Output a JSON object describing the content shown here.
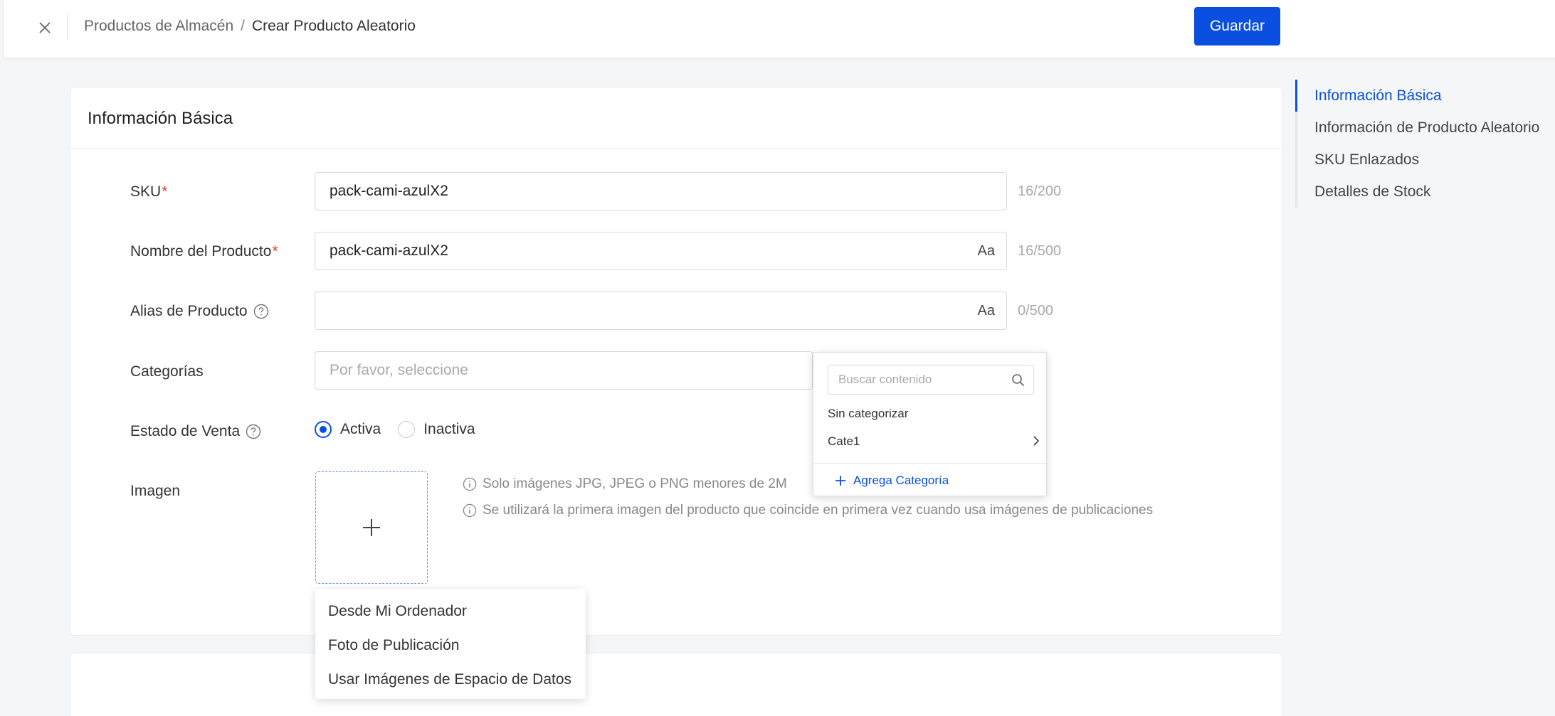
{
  "header": {
    "breadcrumb_parent": "Productos de Almacén",
    "breadcrumb_separator": "/",
    "breadcrumb_current": "Crear Producto Aleatorio",
    "save_label": "Guardar",
    "close_icon": "close-icon"
  },
  "basic_info": {
    "title": "Información Básica",
    "sku": {
      "label": "SKU",
      "required": "*",
      "value": "pack-cami-azulX2",
      "counter": "16/200"
    },
    "product_name": {
      "label": "Nombre del Producto",
      "required": "*",
      "value": "pack-cami-azulX2",
      "case_toggle": "Aa",
      "counter": "16/500"
    },
    "product_alias": {
      "label": "Alias de Producto",
      "value": "",
      "case_toggle": "Aa",
      "counter": "0/500"
    },
    "categories": {
      "label": "Categorías",
      "placeholder": "Por favor, seleccione"
    },
    "sale_status": {
      "label": "Estado de Venta",
      "options": [
        "Activa",
        "Inactiva"
      ],
      "selected": "Activa"
    },
    "image": {
      "label": "Imagen",
      "hints": [
        "Solo imágenes JPG, JPEG o PNG menores de 2M",
        "Se utilizará la primera imagen del producto que coincide en primera vez cuando usa imágenes de publicaciones"
      ]
    }
  },
  "upload_menu": {
    "items": [
      "Desde Mi Ordenador",
      "Foto de Publicación",
      "Usar Imágenes de Espacio de Datos"
    ]
  },
  "category_dropdown": {
    "search_placeholder": "Buscar contenido",
    "items": [
      "Sin categorizar",
      "Cate1"
    ],
    "add_label": "Agrega Categoría"
  },
  "anchor_nav": {
    "items": [
      "Información Básica",
      "Información de Producto Aleatorio",
      "SKU Enlazados",
      "Detalles de Stock"
    ],
    "active": "Información Básica"
  },
  "colors": {
    "accent": "#0a4fe0",
    "required": "#e53935",
    "background": "#f5f6f8"
  }
}
